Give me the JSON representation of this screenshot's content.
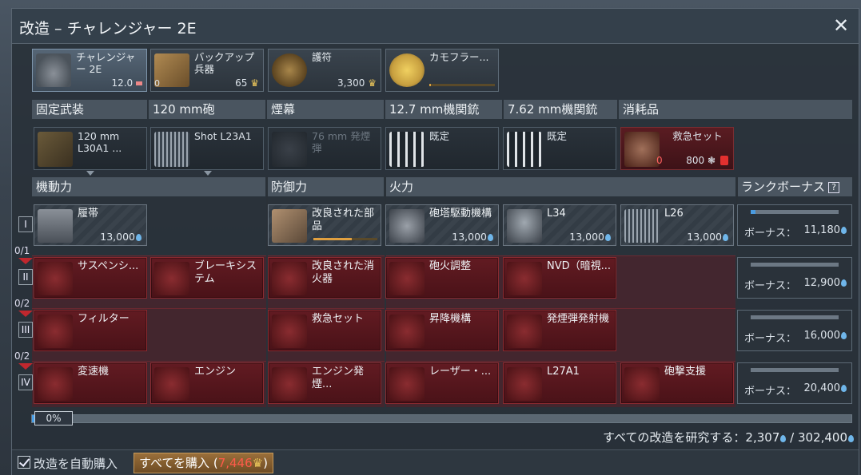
{
  "window": {
    "title": "改造 – チャレンジャー 2E"
  },
  "top_cards": [
    {
      "label": "チャレンジャー 2E",
      "value": "12.0",
      "icon": "tank-icon"
    },
    {
      "label": "バックアップ兵器",
      "left": "0",
      "right": "65",
      "icon": "backup-weapon-icon"
    },
    {
      "label": "護符",
      "right": "3,300",
      "icon": "talisman-icon"
    },
    {
      "label": "カモフラー...",
      "icon": "camouflage-icon"
    }
  ],
  "weapon_headers": [
    "固定武装",
    "120 mm砲",
    "煙幕",
    "12.7 mm機関銃",
    "7.62 mm機関銃",
    "消耗品"
  ],
  "weapons": [
    {
      "label": "120 mm L30A1 ...",
      "icon": "cannon-icon"
    },
    {
      "label": "Shot L23A1",
      "icon": "shell-icon"
    },
    {
      "label": "76 mm 発煙弾",
      "icon": "smoke-icon"
    },
    {
      "label": "既定",
      "icon": "mg-ammo-icon"
    },
    {
      "label": "既定",
      "icon": "mg-ammo-icon"
    },
    {
      "label": "救急セット",
      "left": "0",
      "right": "800",
      "icon": "medkit-icon"
    }
  ],
  "sections": {
    "mobility": "機動力",
    "protection": "防御力",
    "firepower": "火力",
    "rank_bonus": "ランクボーナス",
    "help": "?"
  },
  "ranks": [
    {
      "numeral": "I",
      "frac": "0/1"
    },
    {
      "numeral": "II",
      "frac": "0/2"
    },
    {
      "numeral": "III",
      "frac": "0/2"
    },
    {
      "numeral": "IV",
      "frac": ""
    }
  ],
  "mods": {
    "r1": [
      {
        "label": "履帯",
        "cost": "13,000"
      },
      {
        "label": "改良された部品"
      },
      {
        "label": "砲塔駆動機構",
        "cost": "13,000"
      },
      {
        "label": "L34",
        "cost": "13,000"
      },
      {
        "label": "L26",
        "cost": "13,000"
      }
    ],
    "r2": [
      {
        "label": "サスペンシ..."
      },
      {
        "label": "ブレーキシステム"
      },
      {
        "label": "改良された消火器"
      },
      {
        "label": "砲火調整"
      },
      {
        "label": "NVD（暗視..."
      }
    ],
    "r3": [
      {
        "label": "フィルター"
      },
      {
        "label": "救急セット"
      },
      {
        "label": "昇降機構"
      },
      {
        "label": "発煙弾発射機"
      }
    ],
    "r4": [
      {
        "label": "変速機"
      },
      {
        "label": "エンジン"
      },
      {
        "label": "エンジン発煙..."
      },
      {
        "label": "レーザー・..."
      },
      {
        "label": "L27A1"
      },
      {
        "label": "砲撃支援"
      }
    ]
  },
  "bonuses": [
    {
      "label": "ボーナス：",
      "value": "11,180",
      "progress": 0.05
    },
    {
      "label": "ボーナス：",
      "value": "12,900",
      "progress": 0
    },
    {
      "label": "ボーナス：",
      "value": "16,000",
      "progress": 0
    },
    {
      "label": "ボーナス：",
      "value": "20,400",
      "progress": 0
    }
  ],
  "progress": {
    "percent": "0%",
    "fraction": 0.006
  },
  "research_all": {
    "label": "すべての改造を研究する：",
    "current": "2,307",
    "total": "302,400"
  },
  "bottom": {
    "auto_buy": "改造を自動購入",
    "buy_all": "すべてを購入",
    "buy_all_amount": "7,446"
  },
  "colors": {
    "accent_blue": "#4aa0e8",
    "locked_red": "#621b22",
    "gold": "#e9c45a"
  }
}
